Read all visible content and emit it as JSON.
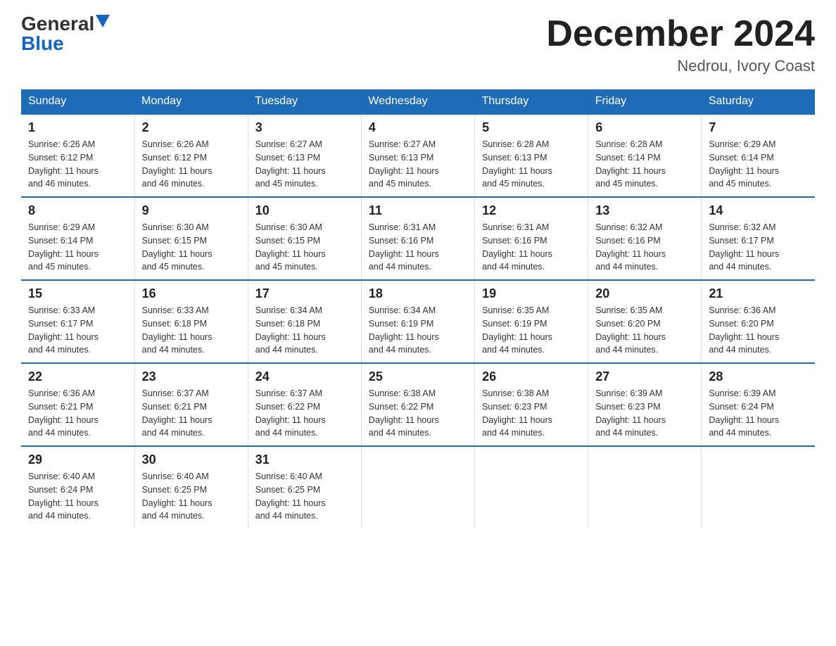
{
  "header": {
    "logo_general": "General",
    "logo_blue": "Blue",
    "month_title": "December 2024",
    "location": "Nedrou, Ivory Coast"
  },
  "days_of_week": [
    "Sunday",
    "Monday",
    "Tuesday",
    "Wednesday",
    "Thursday",
    "Friday",
    "Saturday"
  ],
  "weeks": [
    [
      {
        "day": "1",
        "sunrise": "6:26 AM",
        "sunset": "6:12 PM",
        "daylight": "11 hours and 46 minutes."
      },
      {
        "day": "2",
        "sunrise": "6:26 AM",
        "sunset": "6:12 PM",
        "daylight": "11 hours and 46 minutes."
      },
      {
        "day": "3",
        "sunrise": "6:27 AM",
        "sunset": "6:13 PM",
        "daylight": "11 hours and 45 minutes."
      },
      {
        "day": "4",
        "sunrise": "6:27 AM",
        "sunset": "6:13 PM",
        "daylight": "11 hours and 45 minutes."
      },
      {
        "day": "5",
        "sunrise": "6:28 AM",
        "sunset": "6:13 PM",
        "daylight": "11 hours and 45 minutes."
      },
      {
        "day": "6",
        "sunrise": "6:28 AM",
        "sunset": "6:14 PM",
        "daylight": "11 hours and 45 minutes."
      },
      {
        "day": "7",
        "sunrise": "6:29 AM",
        "sunset": "6:14 PM",
        "daylight": "11 hours and 45 minutes."
      }
    ],
    [
      {
        "day": "8",
        "sunrise": "6:29 AM",
        "sunset": "6:14 PM",
        "daylight": "11 hours and 45 minutes."
      },
      {
        "day": "9",
        "sunrise": "6:30 AM",
        "sunset": "6:15 PM",
        "daylight": "11 hours and 45 minutes."
      },
      {
        "day": "10",
        "sunrise": "6:30 AM",
        "sunset": "6:15 PM",
        "daylight": "11 hours and 45 minutes."
      },
      {
        "day": "11",
        "sunrise": "6:31 AM",
        "sunset": "6:16 PM",
        "daylight": "11 hours and 44 minutes."
      },
      {
        "day": "12",
        "sunrise": "6:31 AM",
        "sunset": "6:16 PM",
        "daylight": "11 hours and 44 minutes."
      },
      {
        "day": "13",
        "sunrise": "6:32 AM",
        "sunset": "6:16 PM",
        "daylight": "11 hours and 44 minutes."
      },
      {
        "day": "14",
        "sunrise": "6:32 AM",
        "sunset": "6:17 PM",
        "daylight": "11 hours and 44 minutes."
      }
    ],
    [
      {
        "day": "15",
        "sunrise": "6:33 AM",
        "sunset": "6:17 PM",
        "daylight": "11 hours and 44 minutes."
      },
      {
        "day": "16",
        "sunrise": "6:33 AM",
        "sunset": "6:18 PM",
        "daylight": "11 hours and 44 minutes."
      },
      {
        "day": "17",
        "sunrise": "6:34 AM",
        "sunset": "6:18 PM",
        "daylight": "11 hours and 44 minutes."
      },
      {
        "day": "18",
        "sunrise": "6:34 AM",
        "sunset": "6:19 PM",
        "daylight": "11 hours and 44 minutes."
      },
      {
        "day": "19",
        "sunrise": "6:35 AM",
        "sunset": "6:19 PM",
        "daylight": "11 hours and 44 minutes."
      },
      {
        "day": "20",
        "sunrise": "6:35 AM",
        "sunset": "6:20 PM",
        "daylight": "11 hours and 44 minutes."
      },
      {
        "day": "21",
        "sunrise": "6:36 AM",
        "sunset": "6:20 PM",
        "daylight": "11 hours and 44 minutes."
      }
    ],
    [
      {
        "day": "22",
        "sunrise": "6:36 AM",
        "sunset": "6:21 PM",
        "daylight": "11 hours and 44 minutes."
      },
      {
        "day": "23",
        "sunrise": "6:37 AM",
        "sunset": "6:21 PM",
        "daylight": "11 hours and 44 minutes."
      },
      {
        "day": "24",
        "sunrise": "6:37 AM",
        "sunset": "6:22 PM",
        "daylight": "11 hours and 44 minutes."
      },
      {
        "day": "25",
        "sunrise": "6:38 AM",
        "sunset": "6:22 PM",
        "daylight": "11 hours and 44 minutes."
      },
      {
        "day": "26",
        "sunrise": "6:38 AM",
        "sunset": "6:23 PM",
        "daylight": "11 hours and 44 minutes."
      },
      {
        "day": "27",
        "sunrise": "6:39 AM",
        "sunset": "6:23 PM",
        "daylight": "11 hours and 44 minutes."
      },
      {
        "day": "28",
        "sunrise": "6:39 AM",
        "sunset": "6:24 PM",
        "daylight": "11 hours and 44 minutes."
      }
    ],
    [
      {
        "day": "29",
        "sunrise": "6:40 AM",
        "sunset": "6:24 PM",
        "daylight": "11 hours and 44 minutes."
      },
      {
        "day": "30",
        "sunrise": "6:40 AM",
        "sunset": "6:25 PM",
        "daylight": "11 hours and 44 minutes."
      },
      {
        "day": "31",
        "sunrise": "6:40 AM",
        "sunset": "6:25 PM",
        "daylight": "11 hours and 44 minutes."
      },
      null,
      null,
      null,
      null
    ]
  ],
  "labels": {
    "sunrise": "Sunrise:",
    "sunset": "Sunset:",
    "daylight": "Daylight:"
  }
}
